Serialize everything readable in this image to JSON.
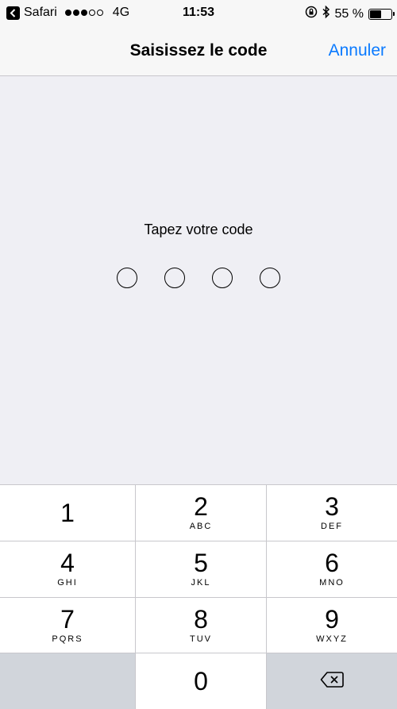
{
  "status_bar": {
    "back_app": "Safari",
    "signal_bars": 3,
    "signal_total": 5,
    "network": "4G",
    "time": "11:53",
    "battery_text": "55 %",
    "battery_level": 0.55
  },
  "nav": {
    "title": "Saisissez le code",
    "cancel_label": "Annuler",
    "accent_color": "#0a7aff"
  },
  "prompt": "Tapez votre code",
  "code_dots_count": 4,
  "keypad": {
    "keys": [
      {
        "num": "1",
        "letters": ""
      },
      {
        "num": "2",
        "letters": "ABC"
      },
      {
        "num": "3",
        "letters": "DEF"
      },
      {
        "num": "4",
        "letters": "GHI"
      },
      {
        "num": "5",
        "letters": "JKL"
      },
      {
        "num": "6",
        "letters": "MNO"
      },
      {
        "num": "7",
        "letters": "PQRS"
      },
      {
        "num": "8",
        "letters": "TUV"
      },
      {
        "num": "9",
        "letters": "WXYZ"
      },
      {
        "num": "0",
        "letters": ""
      }
    ],
    "delete_icon": "delete-backspace-icon"
  }
}
